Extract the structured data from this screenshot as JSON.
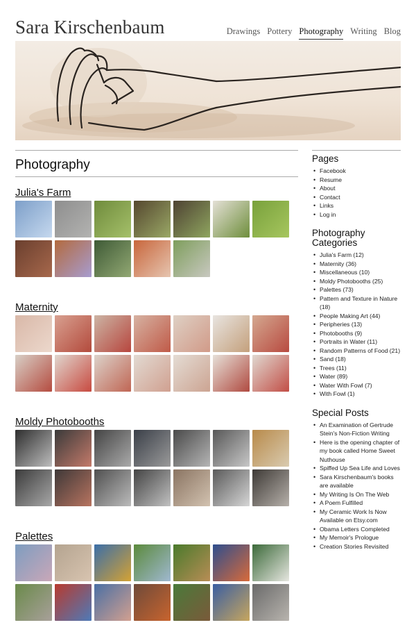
{
  "site": {
    "title": "Sara Kirschenbaum"
  },
  "nav": [
    {
      "label": "Drawings",
      "active": false
    },
    {
      "label": "Pottery",
      "active": false
    },
    {
      "label": "Photography",
      "active": true
    },
    {
      "label": "Writing",
      "active": false
    },
    {
      "label": "Blog",
      "active": false
    }
  ],
  "main": {
    "page_title": "Photography",
    "galleries": [
      {
        "title": "Julia's Farm",
        "count": 12,
        "colors": [
          [
            "#7d9fc9",
            "#c5d8ee"
          ],
          [
            "#8e8e8e",
            "#b3b3b1"
          ],
          [
            "#6f8b3c",
            "#a5c06a"
          ],
          [
            "#55472f",
            "#9aa866"
          ],
          [
            "#4e4233",
            "#8fa55f"
          ],
          [
            "#e4e0d6",
            "#6e8e3b"
          ],
          [
            "#79a13c",
            "#a6c65e"
          ],
          [
            "#6a3f2e",
            "#a7684c"
          ],
          [
            "#b36a3e",
            "#a79cd0"
          ],
          [
            "#3e5a36",
            "#92a873"
          ],
          [
            "#c8663c",
            "#e6c5b0"
          ],
          [
            "#7e9e5c",
            "#c8c8c0"
          ]
        ]
      },
      {
        "title": "Maternity",
        "count": 14,
        "colors": [
          [
            "#d9b8a8",
            "#ecd8cc"
          ],
          [
            "#d8a090",
            "#b34a3c"
          ],
          [
            "#ccb4a4",
            "#b7463e"
          ],
          [
            "#d6b2a2",
            "#c05a48"
          ],
          [
            "#ded0c4",
            "#d19a88"
          ],
          [
            "#e8e4e0",
            "#c4a07c"
          ],
          [
            "#d4a890",
            "#b84a40"
          ],
          [
            "#d8cfc6",
            "#b54c40"
          ],
          [
            "#e0d6ce",
            "#c84a40"
          ],
          [
            "#dcd2ca",
            "#c06654"
          ],
          [
            "#e2dad2",
            "#d0a090"
          ],
          [
            "#e4dcd4",
            "#cca492"
          ],
          [
            "#e6e0d8",
            "#b04a40"
          ],
          [
            "#e0d8d0",
            "#c24e46"
          ]
        ]
      },
      {
        "title": "Moldy Photobooths",
        "count": 14,
        "colors": [
          [
            "#2e2e2e",
            "#bdbdbd"
          ],
          [
            "#3a3a3a",
            "#c47a6a"
          ],
          [
            "#444444",
            "#aaaaaa"
          ],
          [
            "#3a3f48",
            "#9a9a9a"
          ],
          [
            "#4a4a4a",
            "#b5b5b5"
          ],
          [
            "#585858",
            "#c7c7c7"
          ],
          [
            "#b88a4a",
            "#d9cbb0"
          ],
          [
            "#3c3c3c",
            "#a7a7a7"
          ],
          [
            "#3e3838",
            "#b87460"
          ],
          [
            "#505050",
            "#bbbbbb"
          ],
          [
            "#444444",
            "#c1c1c1"
          ],
          [
            "#8a7462",
            "#d2c2b0"
          ],
          [
            "#5a5a5a",
            "#d6d6d6"
          ],
          [
            "#3e3a36",
            "#b6b0aa"
          ]
        ]
      },
      {
        "title": "Palettes",
        "count": 14,
        "colors": [
          [
            "#7e9dc0",
            "#c9a7b8"
          ],
          [
            "#b4a490",
            "#d8c4b0"
          ],
          [
            "#3b6ea8",
            "#d4a234"
          ],
          [
            "#5b8a3c",
            "#9fb8d0"
          ],
          [
            "#4a7a2c",
            "#b88d55"
          ],
          [
            "#2e4e8e",
            "#d86a3a"
          ],
          [
            "#3c6a3a",
            "#e6e6e0"
          ],
          [
            "#6a8a4a",
            "#a8a09a"
          ],
          [
            "#b83a2e",
            "#4e7ab8"
          ],
          [
            "#4a6fa4",
            "#d2a090"
          ],
          [
            "#6e4a3a",
            "#c8642e"
          ],
          [
            "#4a7a3a",
            "#7a5a3a"
          ],
          [
            "#3a5ea2",
            "#c7a65e"
          ],
          [
            "#6a6a6a",
            "#b8b4ae"
          ]
        ]
      }
    ]
  },
  "sidebar": {
    "pages_title": "Pages",
    "pages": [
      "Facebook",
      "Resume",
      "About",
      "Contact",
      "Links",
      "Log in"
    ],
    "categories_title": "Photography Categories",
    "categories": [
      "Julia's Farm (12)",
      "Maternity (36)",
      "Miscellaneous (10)",
      "Moldy Photobooths (25)",
      "Palettes (73)",
      "Pattern and Texture in Nature (18)",
      "People Making Art (44)",
      "Peripheries (13)",
      "Photobooths (9)",
      "Portraits in Water (11)",
      "Random Patterns of Food (21)",
      "Sand (18)",
      "Trees (11)",
      "Water (89)",
      "Water With Fowl (7)",
      "With Fowl (1)"
    ],
    "special_title": "Special Posts",
    "special": [
      "An Examination of Gertrude Stein's Non-Fiction Writing",
      "Here is the opening chapter of my book called Home Sweet Nuthouse",
      "Spiffed Up Sea Life and Loves",
      "Sara Kirschenbaum's books are available",
      "My Writing Is On The Web",
      "A Poem Fulfilled",
      "My Ceramic Work Is Now Available on Etsy.com",
      "Obama Letters Completed",
      "My Memoir's Prologue",
      "Creation Stories Revisited"
    ]
  }
}
